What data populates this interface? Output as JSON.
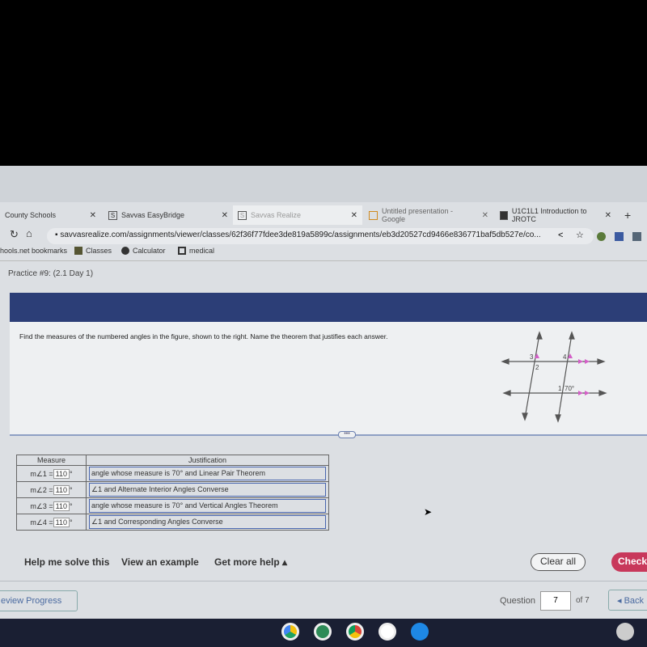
{
  "browser": {
    "tabs": [
      {
        "label": "County Schools",
        "icon": "school-icon"
      },
      {
        "label": "Savvas EasyBridge",
        "icon": "savvas-icon"
      },
      {
        "label": "Savvas Realize",
        "icon": "savvas-icon",
        "active": true
      },
      {
        "label": "Untitled presentation - Google",
        "icon": "slides-icon"
      },
      {
        "label": "U1C1L1 Introduction to JROTC",
        "icon": "classroom-icon"
      }
    ],
    "new_tab": "+",
    "url": "savvasrealize.com/assignments/viewer/classes/62f36f77fdee3de819a5899c/assignments/eb3d20527cd9466e836771baf5db527e/co...",
    "bookmarks": [
      "hools.net bookmarks",
      "Classes",
      "Calculator",
      "medical"
    ]
  },
  "page": {
    "title": "Practice #9: (2.1 Day 1)",
    "prompt": "Find the measures of the numbered angles in the figure, shown to the right. Name the theorem that justifies each answer.",
    "figure": {
      "labels": [
        "3",
        "2",
        "4",
        "1",
        "70°"
      ]
    },
    "table": {
      "headers": [
        "Measure",
        "Justification"
      ],
      "rows": [
        {
          "label": "m∠1 =",
          "value": "110",
          "unit": "°",
          "justification": "angle whose measure is 70° and Linear Pair Theorem"
        },
        {
          "label": "m∠2 =",
          "value": "110",
          "unit": "°",
          "justification": "∠1 and Alternate Interior Angles Converse"
        },
        {
          "label": "m∠3 =",
          "value": "110",
          "unit": "°",
          "justification": "angle whose measure is 70° and Vertical Angles Theorem"
        },
        {
          "label": "m∠4 =",
          "value": "110",
          "unit": "°",
          "justification": "∠1 and Corresponding Angles Converse"
        }
      ]
    },
    "help": [
      "Help me solve this",
      "View an example",
      "Get more help ▴"
    ],
    "clear_all": "Clear all",
    "check": "Check",
    "review_progress": "eview Progress",
    "question_label": "Question",
    "question_value": "7",
    "question_total": "of 7",
    "back": "◂ Back"
  },
  "colors": {
    "banner": "#2c3e77",
    "check": "#c8385b",
    "parallel_marks": "#d45fc8"
  }
}
